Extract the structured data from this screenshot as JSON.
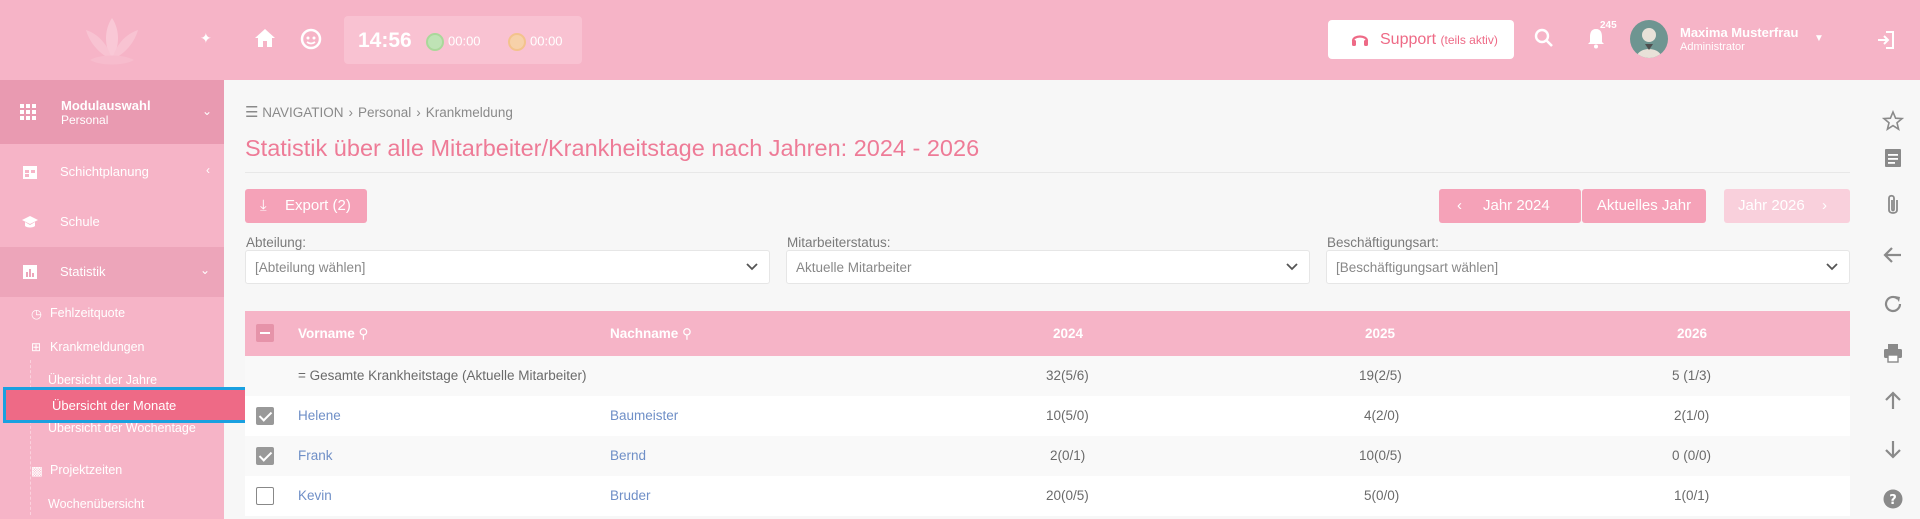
{
  "colors": {
    "accent": "#f6b4c7",
    "primary": "#ee6a86",
    "link": "#6f8fc7"
  },
  "sidebar": {
    "module": {
      "title": "Modulauswahl",
      "subtitle": "Personal"
    },
    "items": [
      {
        "label": "Schichtplanung",
        "icon": "calendar-icon"
      },
      {
        "label": "Schule",
        "icon": "graduation-cap-icon"
      },
      {
        "label": "Statistik",
        "icon": "chart-icon"
      }
    ],
    "subitems": {
      "fehlzeitquote": "Fehlzeitquote",
      "krankmeldungen": "Krankmeldungen",
      "jahre": "Übersicht der Jahre",
      "monate": "Übersicht der Monate",
      "wochentage": "Übersicht der Wochentage",
      "projektzeiten": "Projektzeiten",
      "wochenuebersicht": "Wochenübersicht"
    }
  },
  "topbar": {
    "clock": "14:56",
    "timer1": "00:00",
    "timer2": "00:00",
    "support_label": "Support",
    "support_sub": "(teils aktiv)",
    "notification_count": "245",
    "user_name": "Maxima Musterfrau",
    "user_role": "Administrator"
  },
  "breadcrumb": {
    "root": "NAVIGATION",
    "level1": "Personal",
    "level2": "Krankmeldung"
  },
  "page_title": "Statistik über alle Mitarbeiter/Krankheitstage nach Jahren: 2024 - 2026",
  "toolbar": {
    "export_label": "Export (2)",
    "prev_year": "Jahr 2024",
    "current_year": "Aktuelles Jahr",
    "next_year": "Jahr 2026"
  },
  "filters": {
    "abteilung": {
      "label": "Abteilung:",
      "value": "[Abteilung wählen]"
    },
    "status": {
      "label": "Mitarbeiterstatus:",
      "value": "Aktuelle Mitarbeiter"
    },
    "art": {
      "label": "Beschäftigungsart:",
      "value": "[Beschäftigungsart wählen]"
    }
  },
  "table": {
    "headers": {
      "vorname": "Vorname",
      "nachname": "Nachname",
      "y1": "2024",
      "y2": "2025",
      "y3": "2026"
    },
    "total": {
      "label": "= Gesamte Krankheitstage (Aktuelle Mitarbeiter)",
      "y1": "32(5/6)",
      "y2": "19(2/5)",
      "y3": "5 (1/3)"
    },
    "rows": [
      {
        "vorname": "Helene",
        "nachname": "Baumeister",
        "y1": "10(5/0)",
        "y2": "4(2/0)",
        "y3": "2(1/0)",
        "checked": true
      },
      {
        "vorname": "Frank",
        "nachname": "Bernd",
        "y1": "2(0/1)",
        "y2": "10(0/5)",
        "y3": "0 (0/0)",
        "checked": true
      },
      {
        "vorname": "Kevin",
        "nachname": "Bruder",
        "y1": "20(0/5)",
        "y2": "5(0/0)",
        "y3": "1(0/1)",
        "checked": false
      }
    ]
  }
}
